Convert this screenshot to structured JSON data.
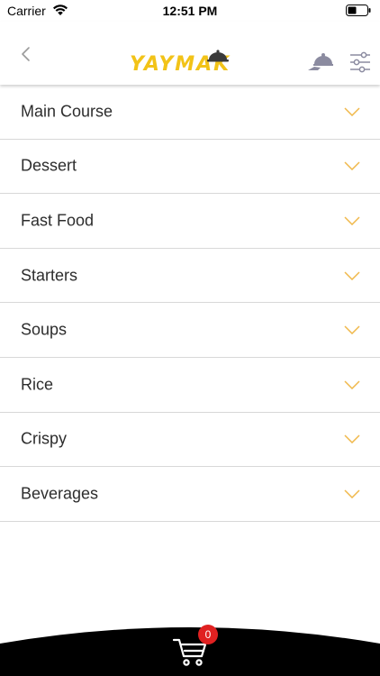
{
  "status_bar": {
    "carrier": "Carrier",
    "time": "12:51 PM"
  },
  "nav": {
    "logo_text": "YAYMAK",
    "icons": {
      "back": "chevron-left-icon",
      "waiter": "serving-cloche-icon",
      "filter": "sliders-icon"
    }
  },
  "categories": [
    {
      "label": "Main Course"
    },
    {
      "label": "Dessert"
    },
    {
      "label": "Fast Food"
    },
    {
      "label": "Starters"
    },
    {
      "label": "Soups"
    },
    {
      "label": "Rice"
    },
    {
      "label": "Crispy"
    },
    {
      "label": "Beverages"
    }
  ],
  "cart": {
    "count": "0",
    "icon": "shopping-cart-icon"
  },
  "colors": {
    "accent": "#f2c318",
    "chevron": "#f0b84a",
    "badge": "#e02121",
    "bottom_bar": "#000000"
  }
}
